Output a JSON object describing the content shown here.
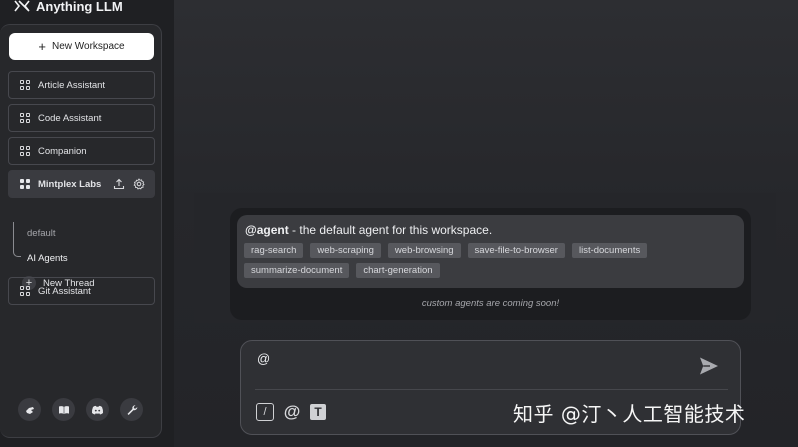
{
  "app": {
    "title": "Anything LLM"
  },
  "sidebar": {
    "new_workspace_label": "New Workspace",
    "workspaces": [
      {
        "label": "Article Assistant"
      },
      {
        "label": "Code Assistant"
      },
      {
        "label": "Companion"
      },
      {
        "label": "Mintplex Labs",
        "active": true
      },
      {
        "label": "Git Assistant"
      }
    ],
    "threads": [
      {
        "label": "default"
      },
      {
        "label": "AI Agents",
        "active": true
      }
    ],
    "new_thread_label": "New Thread",
    "footer_icons": [
      "hand-icon",
      "book-icon",
      "discord-icon",
      "wrench-icon"
    ]
  },
  "agent_popup": {
    "handle": "@agent",
    "description": " - the default agent for this workspace.",
    "skills": [
      "rag-search",
      "web-scraping",
      "web-browsing",
      "save-file-to-browser",
      "list-documents",
      "summarize-document",
      "chart-generation"
    ],
    "footnote": "custom agents are coming soon!"
  },
  "composer": {
    "value": "@",
    "tools": [
      "slash-command-icon",
      "at-mention-icon",
      "text-size-icon"
    ]
  },
  "watermark": "知乎 @汀丶人工智能技术",
  "colors": {
    "background": "#1f2023",
    "sidebar": "#27282b",
    "chip": "#57585d",
    "card": "#3b3c40"
  }
}
